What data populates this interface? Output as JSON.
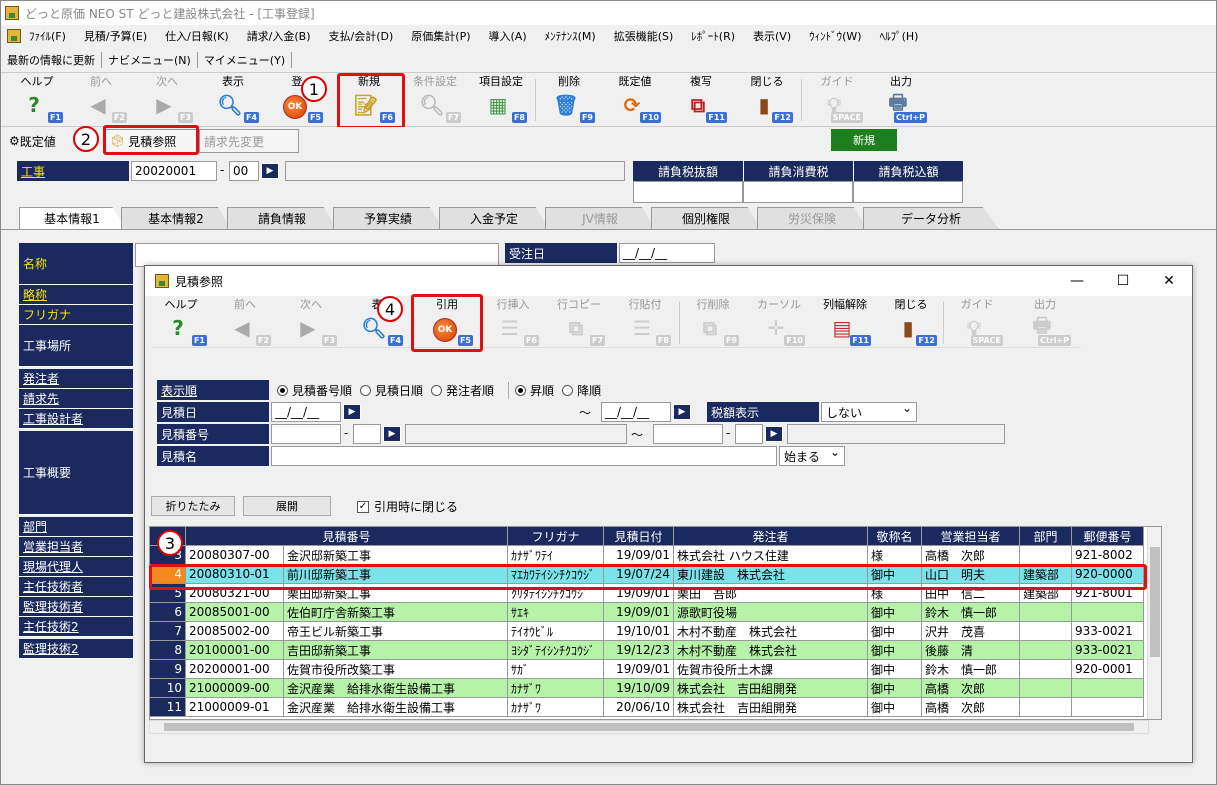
{
  "window": {
    "title": "どっと原価 NEO ST どっと建設株式会社 - [工事登録]"
  },
  "menu": [
    "ﾌｧｲﾙ(F)",
    "見積/予算(E)",
    "仕入/日報(K)",
    "請求/入金(B)",
    "支払/会計(D)",
    "原価集計(P)",
    "導入(A)",
    "ﾒﾝﾃﾅﾝｽ(M)",
    "拡張機能(S)",
    "ﾚﾎﾟｰﾄ(R)",
    "表示(V)",
    "ｳｨﾝﾄﾞｳ(W)",
    "ﾍﾙﾌﾟ(H)"
  ],
  "nav": [
    "最新の情報に更新",
    "ナビメニュー(N)",
    "マイメニュー(Y)"
  ],
  "toolbar": {
    "help": "ヘルプ",
    "help_key": "F1",
    "prev": "前へ",
    "prev_key": "F2",
    "next": "次へ",
    "next_key": "F3",
    "show": "表示",
    "show_key": "F4",
    "register": "登",
    "register_key": "F5",
    "new": "新規",
    "new_key": "F6",
    "cond": "条件設定",
    "cond_key": "F7",
    "items": "項目設定",
    "items_key": "F8",
    "delete": "削除",
    "delete_key": "F9",
    "default": "既定値",
    "default_key": "F10",
    "copy": "複写",
    "copy_key": "F11",
    "close": "閉じる",
    "close_key": "F12",
    "guide": "ガイド",
    "guide_key": "SPACE",
    "output": "出力",
    "output_key": "Ctrl+P"
  },
  "row2": {
    "default_btn": "既定値",
    "estimate_ref": "見積参照",
    "billing_change": "請求先変更",
    "mode": "新規"
  },
  "callouts": {
    "c1": "1",
    "c2": "2",
    "c3": "3",
    "c4": "4"
  },
  "koji": {
    "label": "工事",
    "code": "20020001",
    "dash": "-",
    "sub": "00",
    "tax_headers": [
      "請負税抜額",
      "請負消費税",
      "請負税込額"
    ]
  },
  "tabs": [
    "基本情報1",
    "基本情報2",
    "請負情報",
    "予算実績",
    "入金予定",
    "JV情報",
    "個別権限",
    "労災保険",
    "データ分析"
  ],
  "order_date": {
    "label": "受注日",
    "value": "__/__/__"
  },
  "left_labels": [
    "名称",
    "略称",
    "フリガナ",
    "工事場所",
    "発注者",
    "請求先",
    "工事設計者",
    "工事概要",
    "部門",
    "営業担当者",
    "現場代理人",
    "主任技術者",
    "監理技術者",
    "主任技術2",
    "監理技術2"
  ],
  "dialog": {
    "title": "見積参照",
    "toolbar": {
      "help": "ヘルプ",
      "prev": "前へ",
      "next": "次へ",
      "show": "表",
      "cite": "引用",
      "row_insert": "行挿入",
      "row_copy": "行コピー",
      "row_paste": "行貼付",
      "row_delete": "行削除",
      "cursor": "カーソル",
      "col_release": "列幅解除",
      "close": "閉じる",
      "guide": "ガイド",
      "output": "出力",
      "k1": "F1",
      "k2": "F2",
      "k3": "F3",
      "k4": "F4",
      "k5": "F5",
      "k6": "F6",
      "k7": "F7",
      "k8": "F8",
      "k9": "F9",
      "k10": "F10",
      "k11": "F11",
      "k12": "F12",
      "kspace": "SPACE",
      "kctrl": "Ctrl+P"
    },
    "sort_label": "表示順",
    "sort_options": [
      "見積番号順",
      "見積日順",
      "発注者順"
    ],
    "order_options": [
      "昇順",
      "降順"
    ],
    "f_date": "見積日",
    "f_date_from": "__/__/__",
    "f_date_to": "__/__/__",
    "tilde": "～",
    "f_no": "見積番号",
    "f_name": "見積名",
    "tax_label": "税額表示",
    "tax_value": "しない",
    "match_value": "始まる",
    "fold_btn": "折りたたみ",
    "expand_btn": "展開",
    "close_on_cite": "引用時に閉じる"
  },
  "grid": {
    "headers": [
      "",
      "見積番号",
      "",
      "フリガナ",
      "見積日付",
      "発注者",
      "敬称名",
      "営業担当者",
      "部門",
      "郵便番号"
    ],
    "rows": [
      {
        "n": "3",
        "no": "20080307-00",
        "name": "金沢邸新築工事",
        "kana": "ｶﾅｻﾞﾜﾃｲ",
        "date": "19/09/01",
        "client": "株式会社 ハウス住建",
        "hon": "様",
        "rep": "高橋　次郎",
        "dept": "",
        "zip": "921-8002",
        "style": "white"
      },
      {
        "n": "4",
        "no": "20080310-01",
        "name": "前川邸新築工事",
        "kana": "ﾏｴｶﾜﾃｲｼﾝﾁｸｺｳｼﾞ",
        "date": "19/07/24",
        "client": "東川建設　株式会社",
        "hon": "御中",
        "rep": "山口　明夫",
        "dept": "建築部",
        "zip": "920-0000",
        "style": "cyan"
      },
      {
        "n": "5",
        "no": "20080321-00",
        "name": "栗田邸新築工事",
        "kana": "ｸﾘﾀﾃｲｼﾝﾁｸｺｳｼﾞ",
        "date": "19/09/01",
        "client": "栗田　吾郎",
        "hon": "様",
        "rep": "田中　信二",
        "dept": "建築部",
        "zip": "921-8001",
        "style": "white"
      },
      {
        "n": "6",
        "no": "20085001-00",
        "name": "佐伯町庁舎新築工事",
        "kana": "ｻｴｷ",
        "date": "19/09/01",
        "client": "源歌町役場",
        "hon": "御中",
        "rep": "鈴木　慎一郎",
        "dept": "",
        "zip": "",
        "style": "green"
      },
      {
        "n": "7",
        "no": "20085002-00",
        "name": "帝王ビル新築工事",
        "kana": "ﾃｲｵｳﾋﾞﾙ",
        "date": "19/10/01",
        "client": "木村不動産　株式会社",
        "hon": "御中",
        "rep": "沢井　茂喜",
        "dept": "",
        "zip": "933-0021",
        "style": "white"
      },
      {
        "n": "8",
        "no": "20100001-00",
        "name": "吉田邸新築工事",
        "kana": "ﾖｼﾀﾞﾃｲｼﾝﾁｸｺｳｼﾞ",
        "date": "19/12/23",
        "client": "木村不動産　株式会社",
        "hon": "御中",
        "rep": "後藤　清",
        "dept": "",
        "zip": "933-0021",
        "style": "green"
      },
      {
        "n": "9",
        "no": "20200001-00",
        "name": "佐賀市役所改築工事",
        "kana": "ｻｶﾞ",
        "date": "19/09/01",
        "client": "佐賀市役所土木課",
        "hon": "御中",
        "rep": "鈴木　慎一郎",
        "dept": "",
        "zip": "920-0001",
        "style": "white"
      },
      {
        "n": "10",
        "no": "21000009-00",
        "name": "金沢産業　給排水衛生設備工事",
        "kana": "ｶﾅｻﾞﾜ",
        "date": "19/10/09",
        "client": "株式会社　吉田組開発",
        "hon": "御中",
        "rep": "高橋　次郎",
        "dept": "",
        "zip": "",
        "style": "green"
      },
      {
        "n": "11",
        "no": "21000009-01",
        "name": "金沢産業　給排水衛生設備工事",
        "kana": "ｶﾅｻﾞﾜ",
        "date": "20/06/10",
        "client": "株式会社　吉田組開発",
        "hon": "御中",
        "rep": "高橋　次郎",
        "dept": "",
        "zip": "",
        "style": "white"
      }
    ]
  },
  "colors": {
    "navy": "#1a2a5e",
    "highlight_red": "#e01010",
    "row_green": "#b6f2a8",
    "row_cyan": "#7be2ea",
    "row_num_selected": "#f28a1e"
  }
}
